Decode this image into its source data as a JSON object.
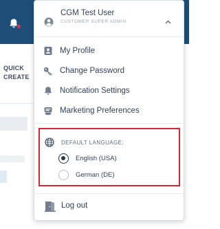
{
  "background": {
    "quick_create_line1": "QUICK",
    "quick_create_line2": "CREATE"
  },
  "user_menu": {
    "user_name": "CGM Test User",
    "user_role": "CUSTOMER SUPER ADMIN",
    "items": [
      {
        "label": "My Profile",
        "icon": "profile-card-icon"
      },
      {
        "label": "Change Password",
        "icon": "key-icon"
      },
      {
        "label": "Notification Settings",
        "icon": "bell-icon"
      },
      {
        "label": "Marketing Preferences",
        "icon": "megaphone-icon"
      }
    ],
    "language": {
      "heading": "DEFAULT LANGUAGE:",
      "options": [
        {
          "label": "English (USA)",
          "selected": true
        },
        {
          "label": "German (DE)",
          "selected": false
        }
      ]
    },
    "logout_label": "Log out"
  },
  "colors": {
    "topbar": "#1f4e79",
    "highlight_border": "#d6252f",
    "notification_dot": "#e0334a",
    "text": "#2f3f55"
  }
}
